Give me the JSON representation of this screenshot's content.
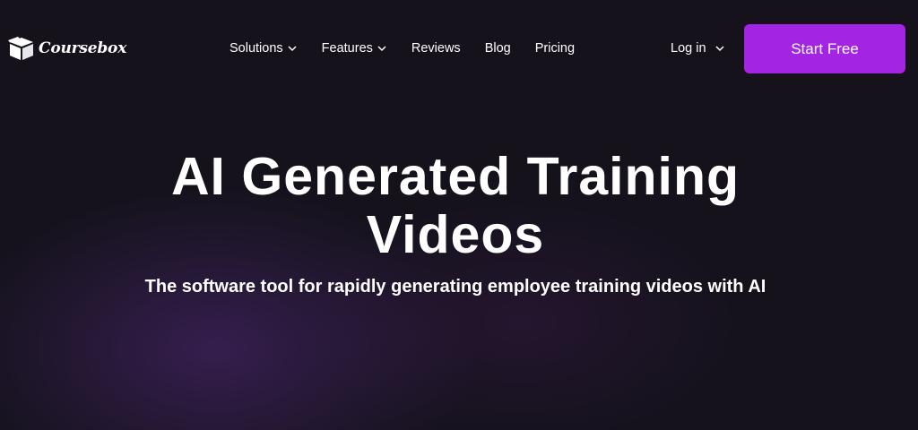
{
  "brand": {
    "name": "Coursebox",
    "logo_icon": "open-box-icon"
  },
  "nav": {
    "items": [
      {
        "label": "Solutions",
        "has_dropdown": true
      },
      {
        "label": "Features",
        "has_dropdown": true
      },
      {
        "label": "Reviews",
        "has_dropdown": false
      },
      {
        "label": "Blog",
        "has_dropdown": false
      },
      {
        "label": "Pricing",
        "has_dropdown": false
      }
    ],
    "login_label": "Log in",
    "cta_label": "Start Free"
  },
  "hero": {
    "title_line1": "AI Generated Training",
    "title_line2": "Videos",
    "subtitle": "The software tool for rapidly generating employee training videos with AI"
  },
  "colors": {
    "background": "#15121c",
    "accent": "#a324e3",
    "text": "#ffffff"
  }
}
